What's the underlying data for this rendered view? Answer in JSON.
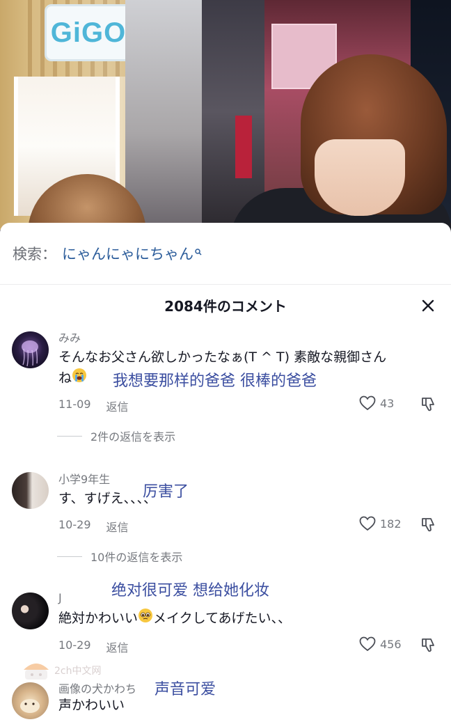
{
  "search": {
    "label": "検索：",
    "term": "にゃんにゃにちゃん"
  },
  "header": {
    "title": "2084件のコメント"
  },
  "comments": [
    {
      "user": "みみ",
      "text_part1": "そんなお父さん欲しかったなぁ(T ^ T) 素敵な親御さん",
      "text_part2": "ね",
      "date": "11-09",
      "reply": "返信",
      "likes": "43",
      "view_replies": "2件の返信を表示",
      "overlay": "我想要那样的爸爸  很棒的爸爸"
    },
    {
      "user": "小学9年生",
      "text": "す、すげえ、、、、",
      "date": "10-29",
      "reply": "返信",
      "likes": "182",
      "view_replies": "10件の返信を表示",
      "overlay": "厉害了"
    },
    {
      "user": "J",
      "text_part1": "絶対かわいい",
      "text_part2": "メイクしてあげたい、、",
      "date": "10-29",
      "reply": "返信",
      "likes": "456",
      "overlay": "绝对很可爱  想给她化妆"
    },
    {
      "user": "画像の犬かわち",
      "text": "声かわいい",
      "overlay": "声音可爱"
    }
  ],
  "watermark": {
    "text": "2ch中文网"
  },
  "icons": {
    "search": "search-icon",
    "close": "close-icon",
    "like": "heart-outline-icon",
    "dislike": "thumbs-down-icon",
    "crying_emoji": "loudly-crying-face-emoji",
    "pleading_emoji": "pleading-face-emoji"
  }
}
